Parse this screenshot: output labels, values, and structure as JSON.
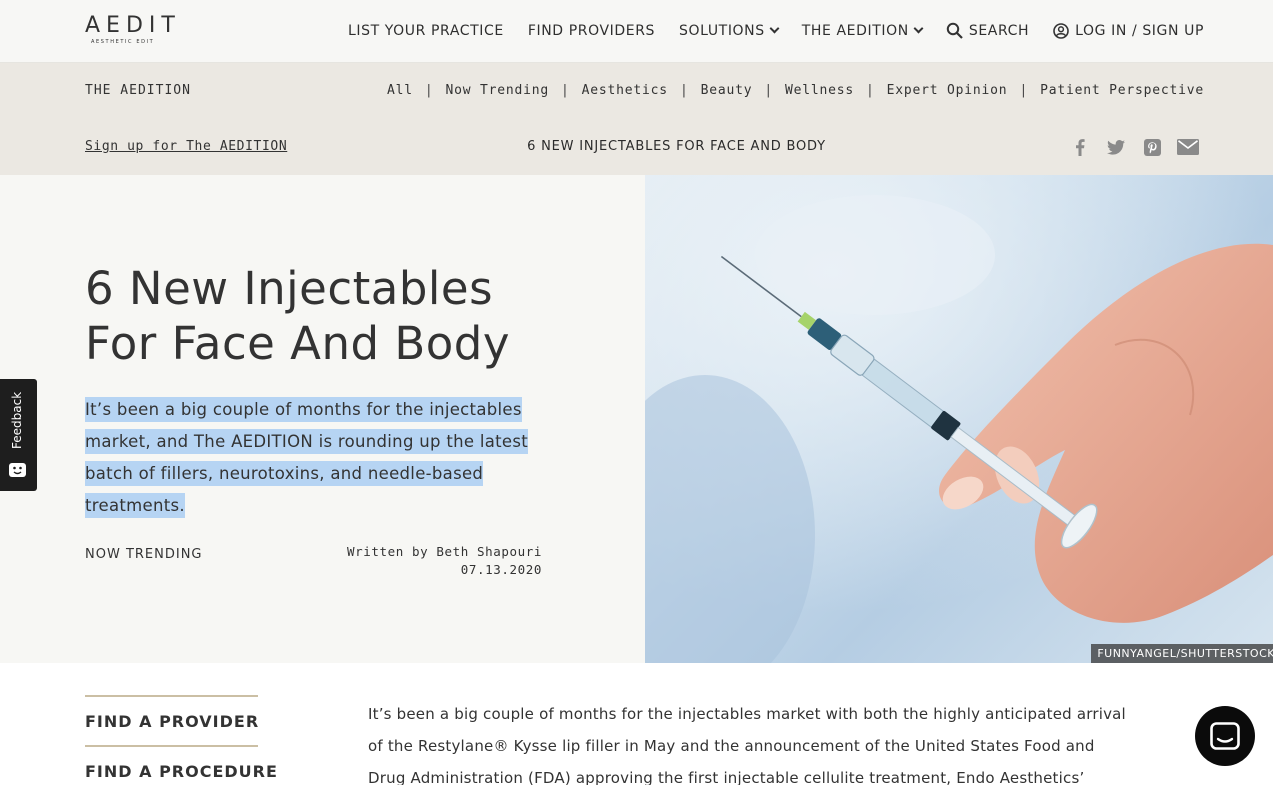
{
  "header": {
    "logo_main": "AEDIT",
    "logo_sub": "AESTHETIC EDIT",
    "nav": [
      {
        "label": "LIST YOUR PRACTICE"
      },
      {
        "label": "FIND PROVIDERS"
      },
      {
        "label": "SOLUTIONS"
      },
      {
        "label": "THE AEDITION"
      },
      {
        "label": "SEARCH"
      },
      {
        "label": "LOG IN / SIGN UP"
      }
    ]
  },
  "aedition_bar": {
    "title": "THE AEDITION",
    "categories": [
      "All",
      "Now Trending",
      "Aesthetics",
      "Beauty",
      "Wellness",
      "Expert Opinion",
      "Patient Perspective"
    ],
    "separator": "|",
    "signup_link": "Sign up for The AEDITION",
    "headline": "6 NEW INJECTABLES FOR FACE AND BODY",
    "share_icons": [
      "facebook-icon",
      "twitter-icon",
      "pinterest-icon",
      "email-icon"
    ]
  },
  "hero": {
    "title": "6 New Injectables For Face And Body",
    "dek": "It’s been a big couple of months for the injectables market, and The AEDITION is rounding up the latest batch of fillers, neurotoxins, and needle-based treatments.",
    "tag": "NOW TRENDING",
    "byline": "Written by Beth Shapouri",
    "date": "07.13.2020",
    "image_credit": "FUNNYANGEL/SHUTTERSTOCK"
  },
  "feedback": {
    "label": "Feedback"
  },
  "sidenav": {
    "items": [
      "FIND A PROVIDER",
      "FIND A PROCEDURE"
    ]
  },
  "article": {
    "body": "It’s been a big couple of months for the injectables market with both the highly anticipated arrival of the Restylane® Kysse lip filler in May and the announcement of the United States Food and Drug Administration (FDA) approving the first injectable cellulite treatment, Endo Aesthetics’"
  },
  "colors": {
    "topnav_bg": "#f7f7f5",
    "aedition_bar_bg": "#ebe8e2",
    "hero_bg": "#f7f7f4",
    "highlight": "#b6d4f3",
    "sidenav_rule": "#cbbfa4"
  }
}
